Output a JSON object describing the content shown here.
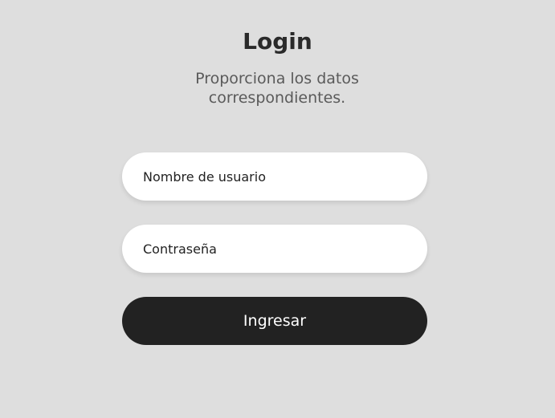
{
  "login": {
    "title": "Login",
    "subtitle": "Proporciona los datos correspondientes.",
    "username": {
      "placeholder": "Nombre de usuario",
      "value": ""
    },
    "password": {
      "placeholder": "Contraseña",
      "value": ""
    },
    "submit_label": "Ingresar"
  },
  "colors": {
    "background": "#dedede",
    "field_background": "#ffffff",
    "button_background": "#222222",
    "button_text": "#ffffff",
    "title_text": "#2a2a2a",
    "subtitle_text": "#5a5a5a"
  }
}
